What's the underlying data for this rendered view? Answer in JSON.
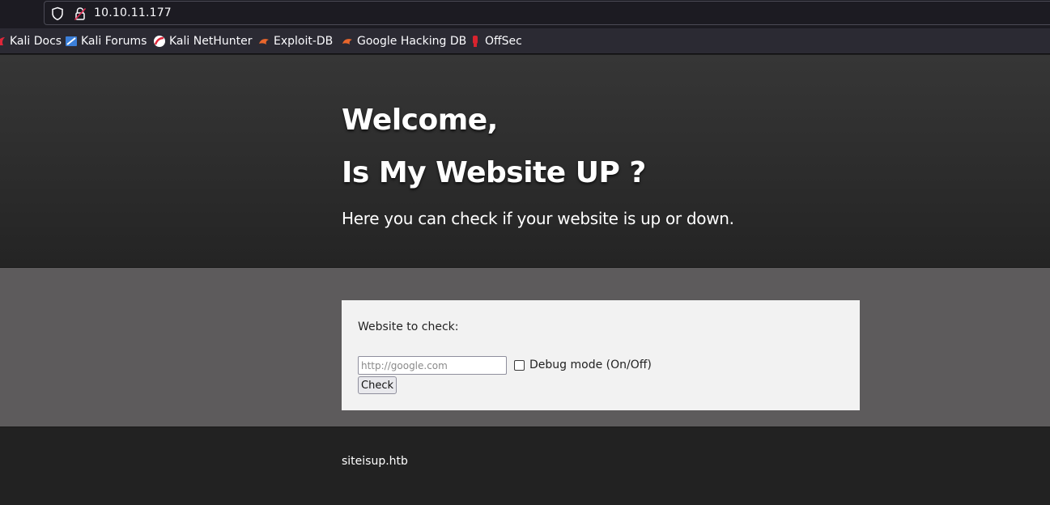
{
  "browser": {
    "url": "10.10.11.177",
    "bookmarks": [
      {
        "label": "Kali Docs",
        "icon": "kali-dragon-red-icon"
      },
      {
        "label": "Kali Forums",
        "icon": "kali-forums-icon"
      },
      {
        "label": "Kali NetHunter",
        "icon": "kali-nethunter-icon"
      },
      {
        "label": "Exploit-DB",
        "icon": "exploit-db-icon"
      },
      {
        "label": "Google Hacking DB",
        "icon": "exploit-db-icon"
      },
      {
        "label": "OffSec",
        "icon": "offsec-icon"
      }
    ]
  },
  "hero": {
    "welcome": "Welcome,",
    "question": "Is My Website UP ?",
    "lead": "Here you can check if your website is up or down."
  },
  "form": {
    "label": "Website to check:",
    "input_value": "",
    "input_placeholder": "http://google.com",
    "debug_label": "Debug mode (On/Off)",
    "debug_checked": false,
    "button_label": "Check"
  },
  "footer": {
    "text": "siteisup.htb"
  },
  "colors": {
    "hero_bg": "#2d2d2d",
    "middle_bg": "#5d5b5c",
    "card_bg": "#f2f2f2",
    "footer_bg": "#222222"
  }
}
